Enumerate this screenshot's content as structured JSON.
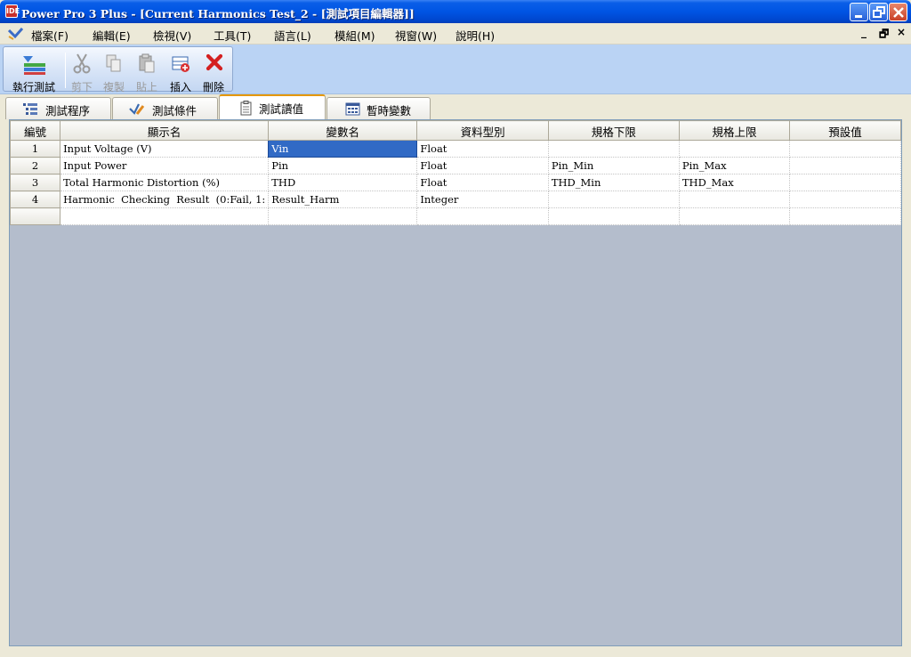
{
  "window": {
    "app_icon": "IDE",
    "title": "Power Pro 3 Plus - [Current Harmonics Test_2 - [測試項目編輯器]]"
  },
  "menu": [
    "檔案(F)",
    "編輯(E)",
    "檢視(V)",
    "工具(T)",
    "語言(L)",
    "模組(M)",
    "視窗(W)",
    "說明(H)"
  ],
  "mdi_controls": [
    "_",
    "🗗",
    "×"
  ],
  "toolbar": {
    "run": "執行測試",
    "cut": "剪下",
    "copy": "複製",
    "paste": "貼上",
    "insert": "插入",
    "delete": "刪除"
  },
  "tabs": [
    "測試程序",
    "測試條件",
    "測試讀值",
    "暫時變數"
  ],
  "active_tab": "測試讀值",
  "grid": {
    "columns": [
      "編號",
      "顯示名",
      "變數名",
      "資料型別",
      "規格下限",
      "規格上限",
      "預設值"
    ],
    "rows": [
      [
        "1",
        "Input Voltage (V)",
        "Vin",
        "Float",
        "",
        "",
        ""
      ],
      [
        "2",
        "Input Power",
        "Pin",
        "Float",
        "Pin_Min",
        "Pin_Max",
        ""
      ],
      [
        "3",
        "Total Harmonic Distortion (%)",
        "THD",
        "Float",
        "THD_Min",
        "THD_Max",
        ""
      ],
      [
        "4",
        "Harmonic  Checking  Result  (0:Fail, 1:",
        "Result_Harm",
        "Integer",
        "",
        "",
        ""
      ],
      [
        "",
        "",
        "",
        "",
        "",
        "",
        ""
      ]
    ],
    "selected_cell": {
      "row": 1,
      "column": "變數名"
    }
  },
  "colors": {
    "title_bar": "#0054e3",
    "toolbar_bg": "#bad3f4",
    "workspace": "#b4bdcc",
    "selection": "#316ac5",
    "active_tab_accent": "#e59700"
  },
  "icons": {
    "run": "run-test-icon",
    "cut": "scissors-icon",
    "copy": "copy-icon",
    "paste": "paste-icon",
    "insert": "insert-row-icon",
    "delete": "red-x-icon"
  }
}
